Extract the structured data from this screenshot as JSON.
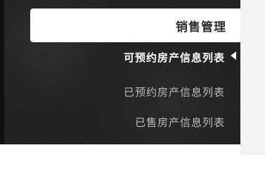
{
  "sidebar": {
    "section_title": "销售管理",
    "items": [
      {
        "label": "可预约房产信息列表",
        "active": true
      },
      {
        "label": "已预约房产信息列表",
        "active": false
      },
      {
        "label": "已售房产信息列表",
        "active": false
      }
    ]
  }
}
